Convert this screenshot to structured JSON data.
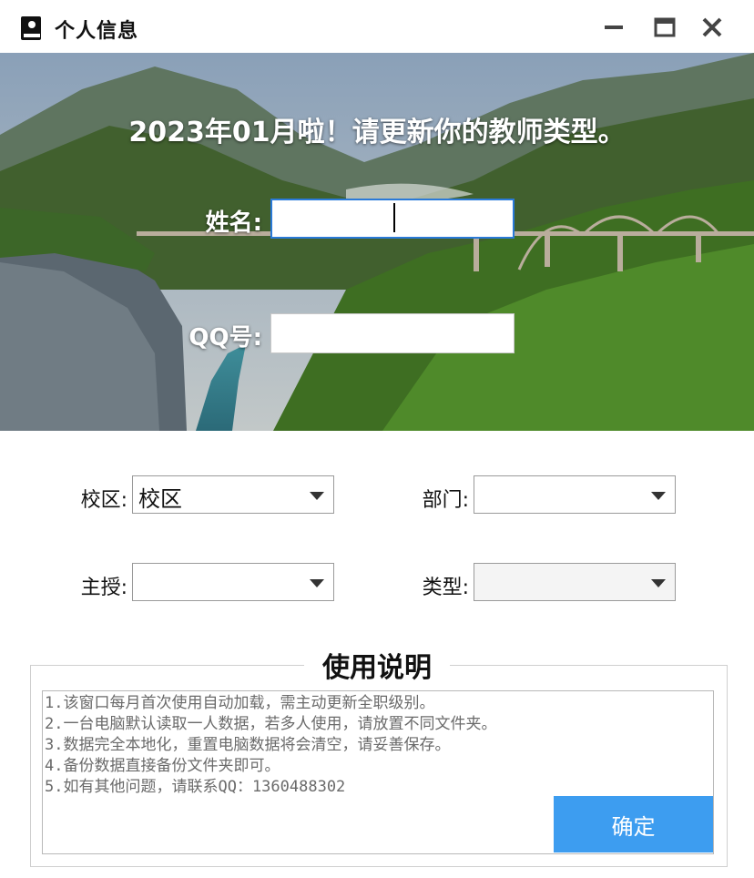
{
  "window": {
    "title": "个人信息",
    "controls": {
      "minimize": "minimize-icon",
      "maximize": "maximize-icon",
      "close": "close-icon"
    }
  },
  "hero": {
    "headline": "2023年01月啦！请更新你的教师类型。",
    "name_label": "姓名:",
    "name_value": "",
    "qq_label": "QQ号:",
    "qq_value": ""
  },
  "form": {
    "campus_label": "校区:",
    "campus_value": "校区",
    "department_label": "部门:",
    "department_value": "",
    "subject_label": "主授:",
    "subject_value": "",
    "type_label": "类型:",
    "type_value": ""
  },
  "instructions": {
    "title": "使用说明",
    "lines": [
      "1.该窗口每月首次使用自动加载，需主动更新全职级别。",
      "2.一台电脑默认读取一人数据，若多人使用，请放置不同文件夹。",
      "3.数据完全本地化，重置电脑数据将会清空，请妥善保存。",
      "4.备份数据直接备份文件夹即可。",
      "5.如有其他问题，请联系QQ：1360488302"
    ],
    "confirm_label": "确定"
  },
  "colors": {
    "accent": "#3d9df0",
    "focus_border": "#2a7ad8"
  }
}
